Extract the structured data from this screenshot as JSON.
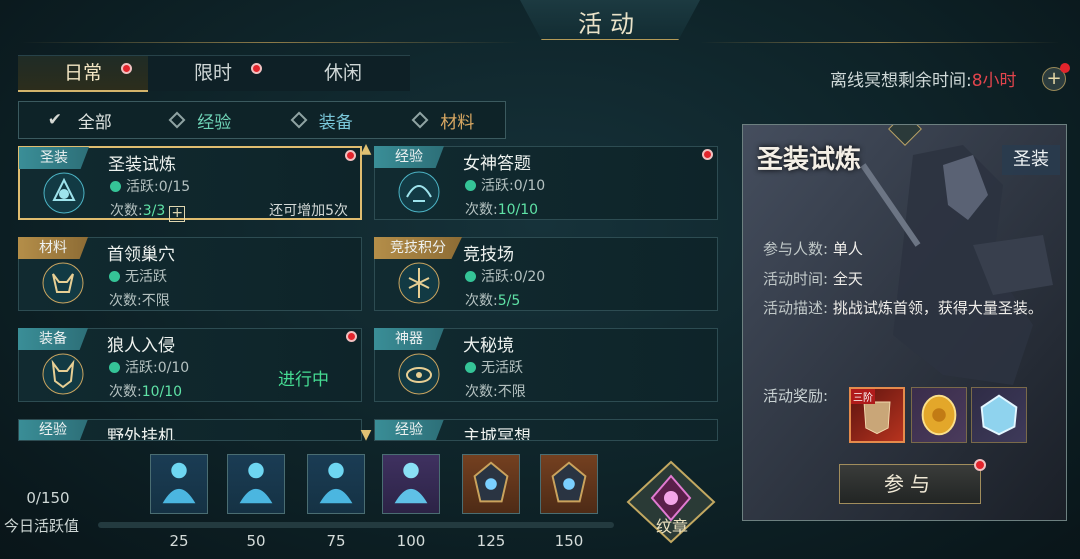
{
  "title": "活动",
  "tabs": [
    {
      "label": "日常",
      "active": true,
      "dot": true
    },
    {
      "label": "限时",
      "active": false,
      "dot": true
    },
    {
      "label": "休闲",
      "active": false,
      "dot": false
    }
  ],
  "offline": {
    "label": "离线冥想剩余时间:",
    "value": "8小时",
    "plus_icon": "plus-icon"
  },
  "filters": [
    {
      "label": "全部",
      "active": true
    },
    {
      "label": "经验",
      "active": false
    },
    {
      "label": "装备",
      "active": false
    },
    {
      "label": "材料",
      "active": false
    }
  ],
  "activities": [
    {
      "tag": "圣装",
      "name": "圣装试炼",
      "activity": "活跃:0/15",
      "times_label": "次数:",
      "times_value": "3/3",
      "extra": "还可增加5次",
      "status": "",
      "dot": true,
      "selected": true
    },
    {
      "tag": "经验",
      "name": "女神答题",
      "activity": "活跃:0/10",
      "times_label": "次数:",
      "times_value": "10/10",
      "extra": "",
      "status": "",
      "dot": true,
      "selected": false
    },
    {
      "tag": "材料",
      "name": "首领巢穴",
      "activity": "无活跃",
      "times_label": "次数:",
      "times_value": "不限",
      "extra": "",
      "status": "",
      "dot": false,
      "selected": false
    },
    {
      "tag": "竞技积分",
      "name": "竞技场",
      "activity": "活跃:0/20",
      "times_label": "次数:",
      "times_value": "5/5",
      "extra": "",
      "status": "",
      "dot": false,
      "selected": false
    },
    {
      "tag": "装备",
      "name": "狼人入侵",
      "activity": "活跃:0/10",
      "times_label": "次数:",
      "times_value": "10/10",
      "extra": "",
      "status": "进行中",
      "dot": true,
      "selected": false
    },
    {
      "tag": "神器",
      "name": "大秘境",
      "activity": "无活跃",
      "times_label": "次数:",
      "times_value": "不限",
      "extra": "",
      "status": "",
      "dot": false,
      "selected": false
    },
    {
      "tag": "经验",
      "name": "野外挂机",
      "activity": "",
      "times_label": "",
      "times_value": "",
      "extra": "",
      "status": "",
      "dot": false,
      "selected": false
    },
    {
      "tag": "经验",
      "name": "主城冥想",
      "activity": "",
      "times_label": "",
      "times_value": "",
      "extra": "",
      "status": "",
      "dot": false,
      "selected": false
    }
  ],
  "detail": {
    "title": "圣装试炼",
    "type": "圣装",
    "participants_label": "参与人数:",
    "participants_value": "单人",
    "time_label": "活动时间:",
    "time_value": "全天",
    "desc_label": "活动描述:",
    "desc_value": "挑战试炼首领，获得大量圣装。",
    "reward_label": "活动奖励:",
    "reward_badge": "三阶",
    "join_label": "参与"
  },
  "progress": {
    "current": "0/150",
    "label": "今日活跃值",
    "fraction": 0,
    "milestones": [
      "25",
      "50",
      "75",
      "100",
      "125",
      "150"
    ]
  },
  "emblem_label": "纹章"
}
